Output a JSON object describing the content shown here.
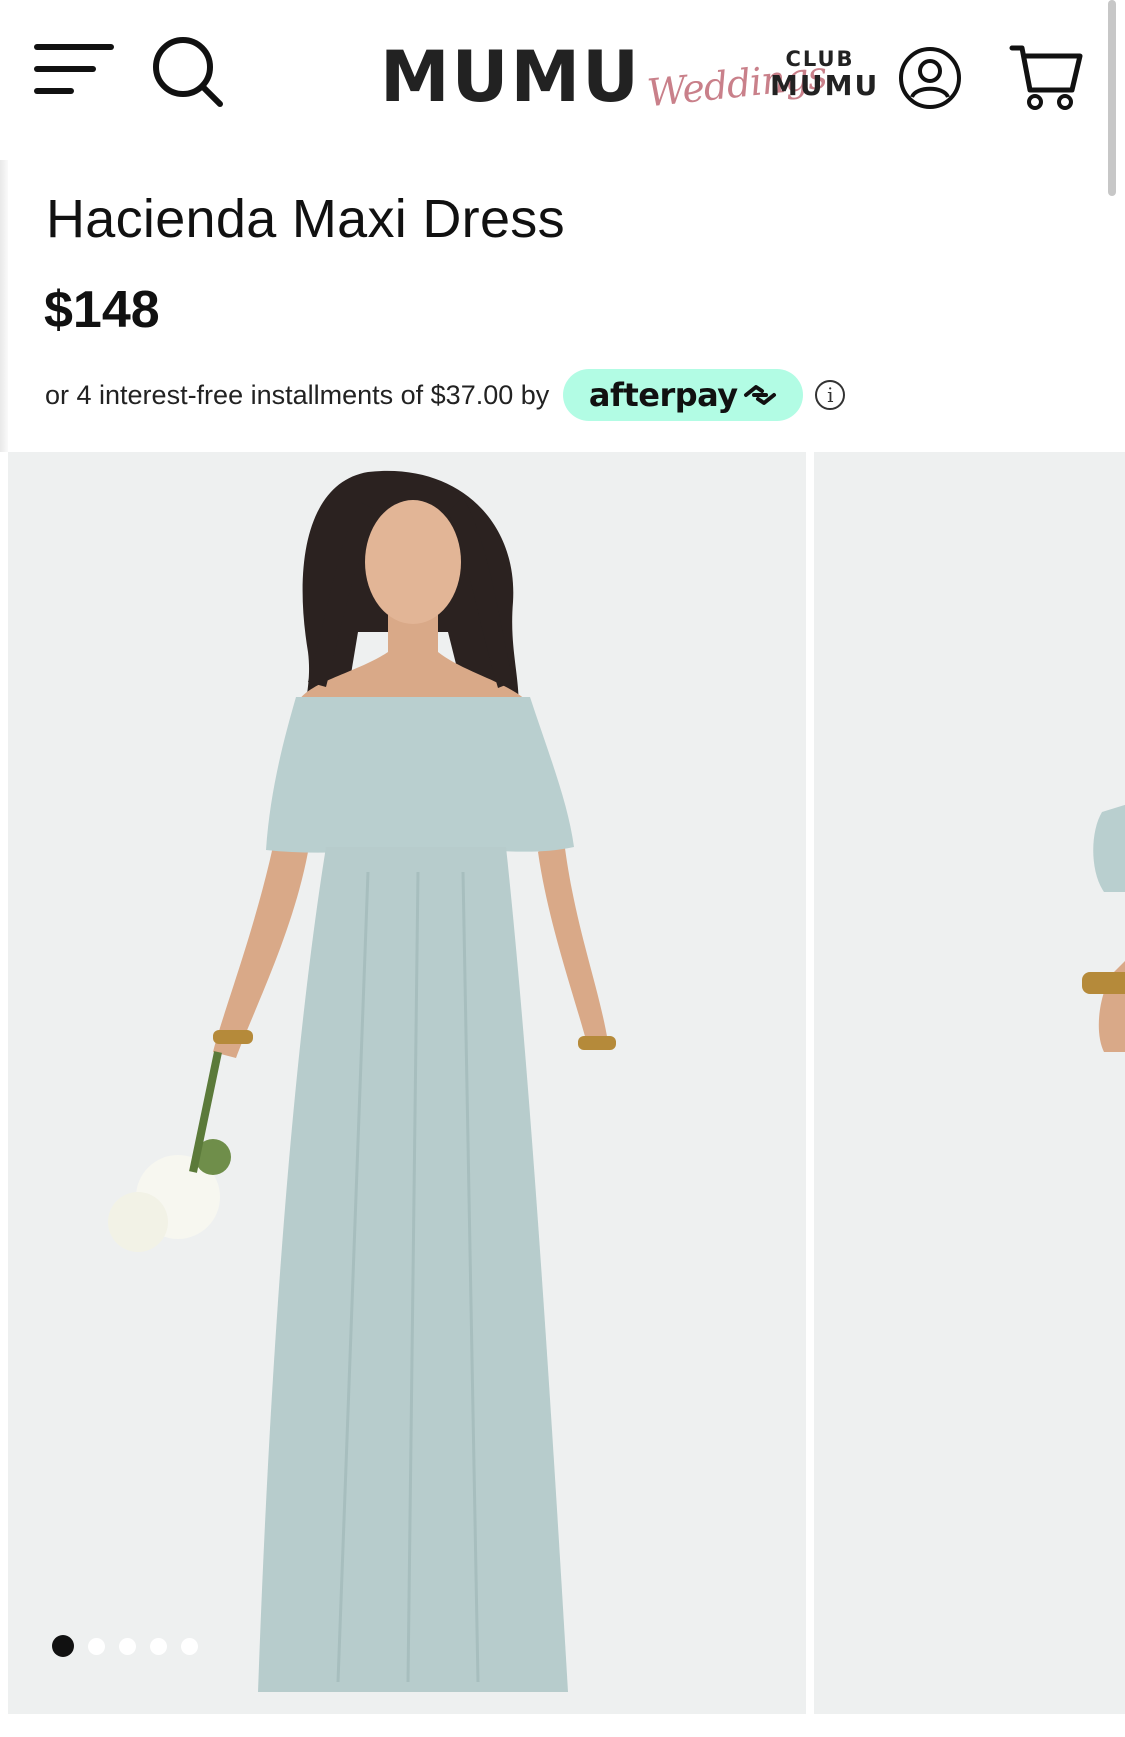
{
  "header": {
    "logo_main": "MUMU",
    "logo_script": "Weddings",
    "club_top": "CLUB",
    "club_bottom": "MUMU",
    "icons": [
      "menu-icon",
      "search-icon",
      "account-icon",
      "cart-icon"
    ]
  },
  "product": {
    "title": "Hacienda Maxi Dress",
    "price": "$148",
    "installments_text": "or 4 interest-free installments of $37.00 by",
    "afterpay_label": "afterpay",
    "info_symbol": "i"
  },
  "gallery": {
    "slide_count": 5,
    "active_index": 0
  },
  "colors": {
    "afterpay_mint": "#b2fce4",
    "logo_script_pink": "#c9808a",
    "dress_sage": "#b7cccc",
    "photo_background": "#eef0f0"
  }
}
